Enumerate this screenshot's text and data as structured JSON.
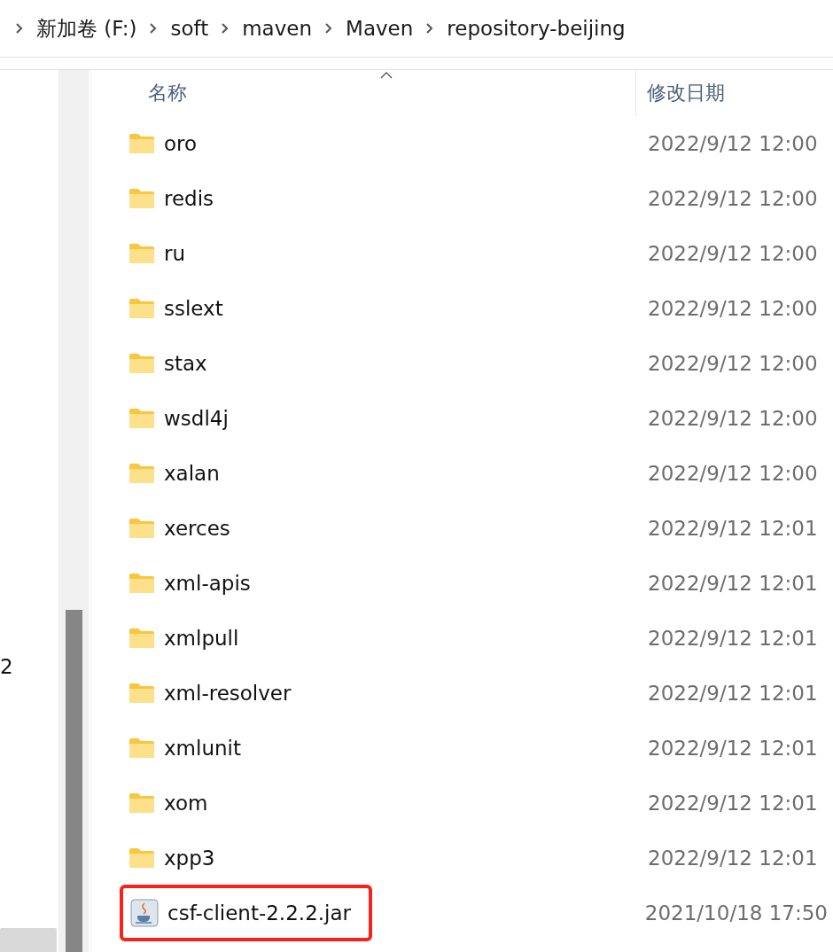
{
  "breadcrumb": [
    "新加卷 (F:)",
    "soft",
    "maven",
    "Maven",
    "repository-beijing"
  ],
  "nav_pane": {
    "items": [
      "2"
    ]
  },
  "columns": [
    {
      "label": "名称",
      "sorted": true
    },
    {
      "label": "修改日期",
      "sorted": false
    }
  ],
  "files": [
    {
      "name": "oro",
      "date": "2022/9/12 12:00",
      "kind": "folder",
      "highlighted": false
    },
    {
      "name": "redis",
      "date": "2022/9/12 12:00",
      "kind": "folder",
      "highlighted": false
    },
    {
      "name": "ru",
      "date": "2022/9/12 12:00",
      "kind": "folder",
      "highlighted": false
    },
    {
      "name": "sslext",
      "date": "2022/9/12 12:00",
      "kind": "folder",
      "highlighted": false
    },
    {
      "name": "stax",
      "date": "2022/9/12 12:00",
      "kind": "folder",
      "highlighted": false
    },
    {
      "name": "wsdl4j",
      "date": "2022/9/12 12:00",
      "kind": "folder",
      "highlighted": false
    },
    {
      "name": "xalan",
      "date": "2022/9/12 12:00",
      "kind": "folder",
      "highlighted": false
    },
    {
      "name": "xerces",
      "date": "2022/9/12 12:01",
      "kind": "folder",
      "highlighted": false
    },
    {
      "name": "xml-apis",
      "date": "2022/9/12 12:01",
      "kind": "folder",
      "highlighted": false
    },
    {
      "name": "xmlpull",
      "date": "2022/9/12 12:01",
      "kind": "folder",
      "highlighted": false
    },
    {
      "name": "xml-resolver",
      "date": "2022/9/12 12:01",
      "kind": "folder",
      "highlighted": false
    },
    {
      "name": "xmlunit",
      "date": "2022/9/12 12:01",
      "kind": "folder",
      "highlighted": false
    },
    {
      "name": "xom",
      "date": "2022/9/12 12:01",
      "kind": "folder",
      "highlighted": false
    },
    {
      "name": "xpp3",
      "date": "2022/9/12 12:01",
      "kind": "folder",
      "highlighted": false
    },
    {
      "name": "csf-client-2.2.2.jar",
      "date": "2021/10/18 17:50",
      "kind": "jar",
      "highlighted": true
    }
  ]
}
